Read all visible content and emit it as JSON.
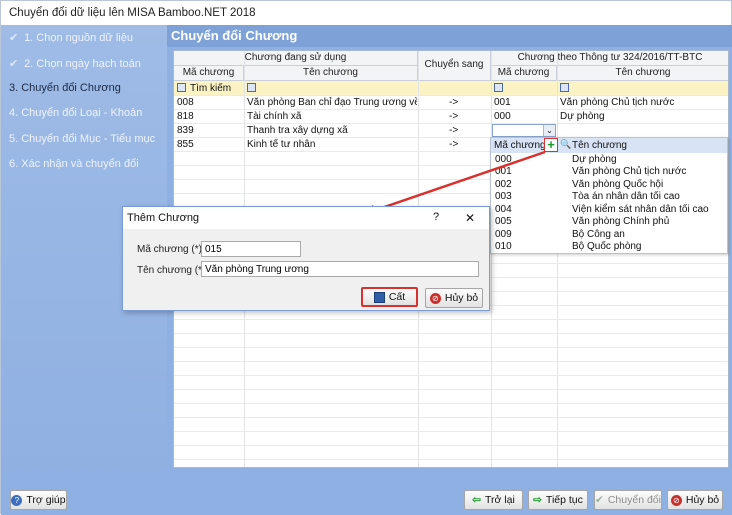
{
  "window": {
    "title": "Chuyển đổi dữ liệu lên MISA Bamboo.NET 2018"
  },
  "sidebar": {
    "steps": [
      {
        "label": "1. Chọn nguồn dữ liệu",
        "done": true
      },
      {
        "label": "2. Chọn ngày hạch toán",
        "done": true
      },
      {
        "label": "3. Chuyển đổi Chương",
        "active": true
      },
      {
        "label": "4. Chuyển đổi Loại - Khoản"
      },
      {
        "label": "5. Chuyển đổi Mục - Tiểu mục"
      },
      {
        "label": "6. Xác nhận và chuyển đổi"
      }
    ]
  },
  "header": {
    "title": "Chuyển đổi Chương"
  },
  "grid": {
    "group_left": "Chương đang sử dụng",
    "col_convert": "Chuyển sang",
    "group_right": "Chương theo Thông tư 324/2016/TT-BTC",
    "col_ma": "Mã chương",
    "col_ten": "Tên chương",
    "col_ma_r": "Mã chương",
    "col_ten_r": "Tên chương",
    "filter_label": "Tìm kiếm",
    "rows": [
      {
        "ma": "008",
        "ten": "Văn phòng Ban chỉ đạo Trung ương về p...",
        "arrow": "->",
        "ma_r": "001",
        "ten_r": "Văn phòng Chủ tịch nước"
      },
      {
        "ma": "818",
        "ten": "Tài chính xã",
        "arrow": "->",
        "ma_r": "000",
        "ten_r": "Dự phòng"
      },
      {
        "ma": "839",
        "ten": "Thanh tra xây dựng xã",
        "arrow": "->",
        "ma_r": "",
        "ten_r": ""
      },
      {
        "ma": "855",
        "ten": "Kinh tế tư nhân",
        "arrow": "->",
        "ma_r": "",
        "ten_r": ""
      }
    ]
  },
  "dropdown": {
    "col_ma": "Mã chương",
    "col_ten": "Tên chương",
    "items": [
      {
        "ma": "000",
        "ten": "Dự phòng"
      },
      {
        "ma": "001",
        "ten": "Văn phòng Chủ tịch nước"
      },
      {
        "ma": "002",
        "ten": "Văn phòng Quốc hội"
      },
      {
        "ma": "003",
        "ten": "Tòa án nhân dân tối cao"
      },
      {
        "ma": "004",
        "ten": "Viện kiểm sát nhân dân tối cao"
      },
      {
        "ma": "005",
        "ten": "Văn phòng Chính phủ"
      },
      {
        "ma": "009",
        "ten": "Bộ Công an"
      },
      {
        "ma": "010",
        "ten": "Bộ Quốc phòng"
      }
    ]
  },
  "dialog": {
    "title": "Thêm Chương",
    "help": "?",
    "close": "✕",
    "label_ma": "Mã chương (*)",
    "value_ma": "015",
    "label_ten": "Tên chương (*)",
    "value_ten": "Văn phòng Trung ương",
    "save": "Cất",
    "cancel": "Hủy bỏ"
  },
  "footer": {
    "help": "Trợ giúp",
    "back": "Trở lại",
    "next": "Tiếp tục",
    "convert": "Chuyển đổi",
    "cancel": "Hủy bỏ"
  },
  "colors": {
    "sidebar": "#8fb0e2",
    "header": "#7ea2d8",
    "highlight": "#d9322e",
    "filter": "#fbf3c4"
  }
}
